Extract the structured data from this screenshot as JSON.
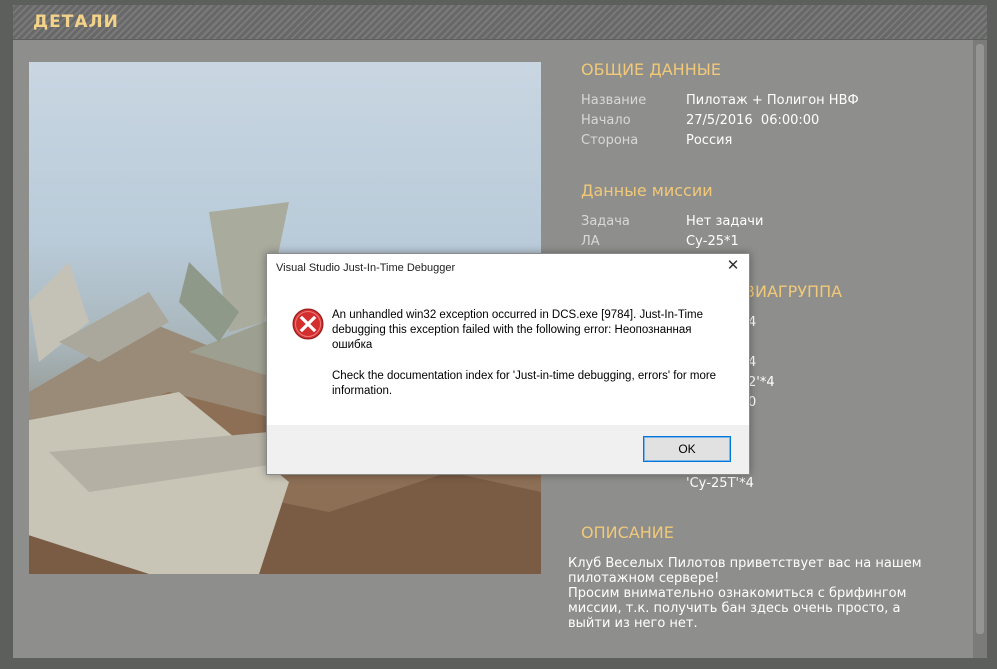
{
  "header": {
    "title": "ДЕТАЛИ"
  },
  "general": {
    "title": "ОБЩИЕ ДАННЫЕ",
    "rows": [
      {
        "label": "Название",
        "value": "Пилотаж + Полигон НВФ"
      },
      {
        "label": "Начало",
        "value": "27/5/2016  06:00:00"
      },
      {
        "label": "Сторона",
        "value": "Россия"
      }
    ]
  },
  "mission": {
    "title": "Данные миссии",
    "rows": [
      {
        "label": "Задача",
        "value": "Нет задачи"
      },
      {
        "label": "ЛА",
        "value": "Су-25*1"
      }
    ]
  },
  "flight_group": {
    "title_partial": "ВИАГРУППА",
    "partial_values": [
      "4",
      "4",
      "2'*4",
      "0",
      "'Су-25Т'*4"
    ]
  },
  "description": {
    "title": "ОПИСАНИЕ",
    "text": " Клуб Веселых Пилотов приветствует вас на нашем пилотажном сервере!\n Просим внимательно ознакомиться с брифингом миссии, т.к. получить бан здесь очень просто, а выйти из него нет."
  },
  "dialog": {
    "title": "Visual Studio Just-In-Time Debugger",
    "close_glyph": "✕",
    "icon": "error-icon",
    "message": "An unhandled win32 exception occurred in DCS.exe [9784]. Just-In-Time debugging this exception failed with the following error: Неопознанная ошибка",
    "hint": "Check the documentation index for 'Just-in-time debugging, errors' for more information.",
    "ok_label": "OK"
  },
  "colors": {
    "accent": "#f1c978",
    "panel": "#8e8f8d",
    "dialog_border": "#0078d7",
    "error_red": "#d32f2f"
  }
}
